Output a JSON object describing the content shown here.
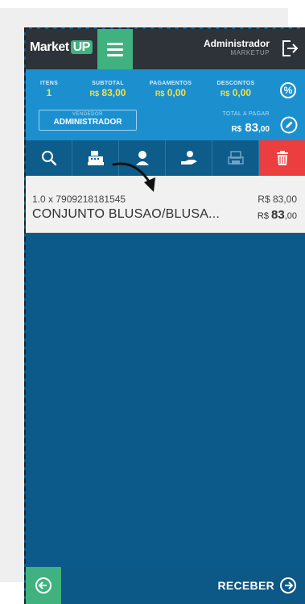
{
  "app": {
    "brand_main": "Market",
    "brand_accent": "UP"
  },
  "user": {
    "name": "Administrador",
    "company": "MARKETUP"
  },
  "summary": {
    "itens_label": "ITENS",
    "itens_value": "1",
    "subtotal_label": "SUBTOTAL",
    "subtotal_currency": "R$",
    "subtotal_value": "83,00",
    "pagamentos_label": "PAGAMENTOS",
    "pagamentos_currency": "R$",
    "pagamentos_value": "0,00",
    "descontos_label": "DESCONTOS",
    "descontos_currency": "R$",
    "descontos_value": "0,00",
    "percent_symbol": "%",
    "vendedor_label": "VENDEDOR",
    "vendedor_name": "ADMINISTRADOR",
    "total_label": "TOTAL A PAGAR",
    "total_currency": "R$",
    "total_int": "83",
    "total_cents": ",00"
  },
  "toolbar": [
    "search-icon",
    "cash-register-icon",
    "customer-icon",
    "hand-money-icon",
    "printer-icon",
    "trash-icon"
  ],
  "item": {
    "qty_code": "1.0 x 7909218181545",
    "unit_price": "R$ 83,00",
    "name": "CONJUNTO BLUSAO/BLUSA...",
    "total_currency": "R$",
    "total_int": "83",
    "total_cents": ",00"
  },
  "footer": {
    "receive_label": "RECEBER"
  },
  "colors": {
    "topbar": "#2d3338",
    "accent_green": "#3fb27f",
    "summary_blue": "#1c90cf",
    "toolbar_blue": "#0e5c8a",
    "delete_red": "#ec3e3e",
    "body_blue": "#0b5a89",
    "value_yellow": "#f1e04b"
  }
}
